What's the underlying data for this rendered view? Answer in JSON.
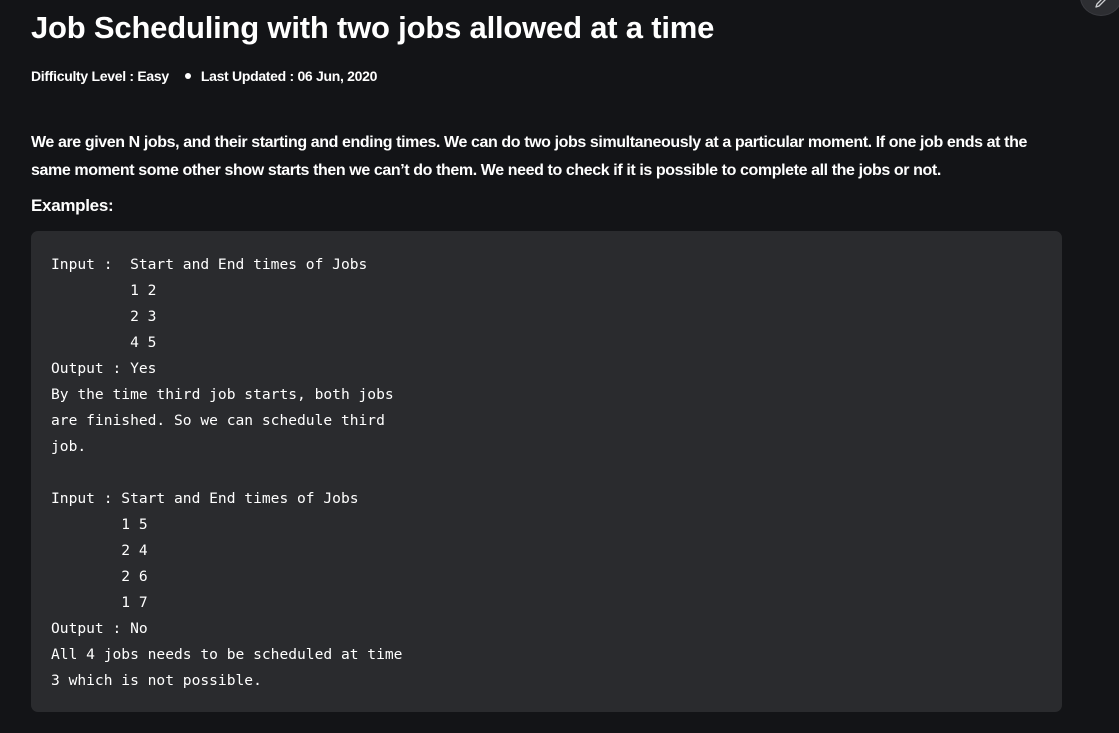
{
  "article": {
    "title": "Job Scheduling with two jobs allowed at a time",
    "difficulty": "Difficulty Level : Easy",
    "last_updated": "Last Updated : 06 Jun, 2020",
    "intro": "We are given N jobs, and their starting and ending times. We can do two jobs simultaneously at a particular moment. If one job ends at the same moment some other show starts then we can’t do them. We need to check if it is possible to complete all the jobs or not.",
    "examples_heading": "Examples:",
    "code": "Input :  Start and End times of Jobs\n         1 2\n         2 3\n         4 5\nOutput : Yes\nBy the time third job starts, both jobs\nare finished. So we can schedule third\njob.\n\nInput : Start and End times of Jobs\n        1 5\n        2 4\n        2 6\n        1 7\nOutput : No\nAll 4 jobs needs to be scheduled at time\n3 which is not possible."
  },
  "toolbar": {
    "edit_icon": "pencil-icon"
  },
  "colors": {
    "background": "#131417",
    "code_background": "#2a2b2e",
    "text": "#ffffff"
  }
}
